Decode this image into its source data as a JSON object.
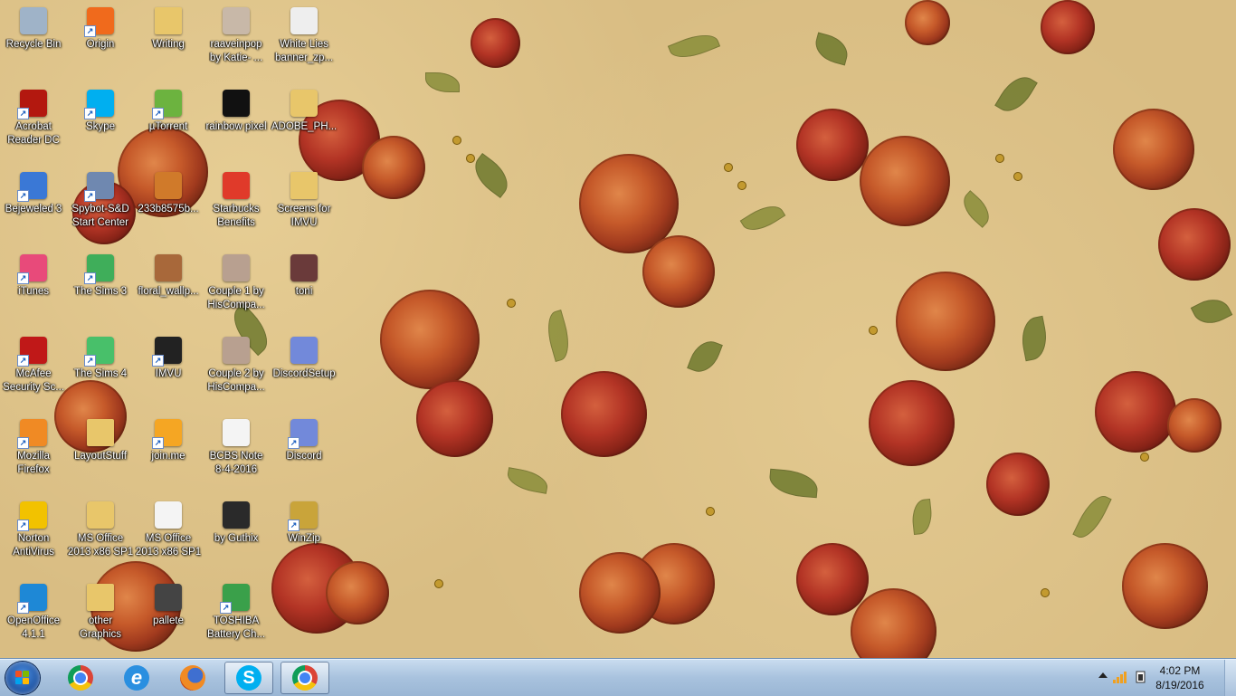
{
  "desktop": {
    "icons": [
      {
        "label": "Recycle Bin",
        "icon": "recycle-bin-icon",
        "color": "#9fb3c8",
        "shortcut": false
      },
      {
        "label": "Origin",
        "icon": "origin-icon",
        "color": "#f06a1c",
        "shortcut": true
      },
      {
        "label": "Writing",
        "icon": "folder-icon",
        "color": "#e8c66a",
        "shortcut": false
      },
      {
        "label": "raaveinpop\nby Katie- ...",
        "icon": "image-file-icon",
        "color": "#c8b8a8",
        "shortcut": false
      },
      {
        "label": "White Lies\nbanner_zp...",
        "icon": "image-file-icon",
        "color": "#eeeeee",
        "shortcut": false
      },
      {
        "label": "Acrobat\nReader DC",
        "icon": "acrobat-icon",
        "color": "#b3180f",
        "shortcut": true
      },
      {
        "label": "Skype",
        "icon": "skype-icon",
        "color": "#00aff0",
        "shortcut": true
      },
      {
        "label": "µTorrent",
        "icon": "utorrent-icon",
        "color": "#6cb33f",
        "shortcut": true
      },
      {
        "label": "rainbow pixel",
        "icon": "image-file-icon",
        "color": "#111111",
        "shortcut": false
      },
      {
        "label": "ADOBE_PH...",
        "icon": "zip-file-icon",
        "color": "#e8c66a",
        "shortcut": false
      },
      {
        "label": "Bejeweled 3",
        "icon": "bejeweled-icon",
        "color": "#3a78d6",
        "shortcut": true
      },
      {
        "label": "Spybot-S&D\nStart Center",
        "icon": "spybot-icon",
        "color": "#6f88b0",
        "shortcut": true
      },
      {
        "label": "233b8575b...",
        "icon": "image-file-icon",
        "color": "#d07a2a",
        "shortcut": false
      },
      {
        "label": "Starbucks\nBenefits",
        "icon": "pdf-file-icon",
        "color": "#e03a2a",
        "shortcut": false
      },
      {
        "label": "Screens for\nIMVU",
        "icon": "folder-icon",
        "color": "#e8c66a",
        "shortcut": false
      },
      {
        "label": "iTunes",
        "icon": "itunes-icon",
        "color": "#e84a7a",
        "shortcut": true
      },
      {
        "label": "The Sims 3",
        "icon": "sims-icon",
        "color": "#3fae5a",
        "shortcut": true
      },
      {
        "label": "floral_wallp...",
        "icon": "image-file-icon",
        "color": "#a8683a",
        "shortcut": false
      },
      {
        "label": "Couple 1 by\nHisCompa...",
        "icon": "image-file-icon",
        "color": "#b8a090",
        "shortcut": false
      },
      {
        "label": "toni",
        "icon": "image-file-icon",
        "color": "#6a3a3a",
        "shortcut": false
      },
      {
        "label": "McAfee\nSecurity Sc...",
        "icon": "mcafee-icon",
        "color": "#c01818",
        "shortcut": true
      },
      {
        "label": "The Sims 4",
        "icon": "sims-icon",
        "color": "#48c06a",
        "shortcut": true
      },
      {
        "label": "IMVU",
        "icon": "imvu-icon",
        "color": "#222222",
        "shortcut": true
      },
      {
        "label": "Couple 2 by\nHisCompa...",
        "icon": "image-file-icon",
        "color": "#b8a090",
        "shortcut": false
      },
      {
        "label": "DiscordSetup",
        "icon": "discord-icon",
        "color": "#7289da",
        "shortcut": false
      },
      {
        "label": "Mozilla\nFirefox",
        "icon": "firefox-icon",
        "color": "#f08a24",
        "shortcut": true
      },
      {
        "label": "LayoutStuff",
        "icon": "folder-icon",
        "color": "#e8c66a",
        "shortcut": false
      },
      {
        "label": "join.me",
        "icon": "joinme-icon",
        "color": "#f5a623",
        "shortcut": true
      },
      {
        "label": "BCBS Note\n8-4-2016",
        "icon": "text-file-icon",
        "color": "#f4f4f4",
        "shortcut": false
      },
      {
        "label": "Discord",
        "icon": "discord-icon",
        "color": "#7289da",
        "shortcut": true
      },
      {
        "label": "Norton\nAntiVirus",
        "icon": "norton-icon",
        "color": "#f2c200",
        "shortcut": true
      },
      {
        "label": "MS Office\n2013 x86 SP1",
        "icon": "zip-file-icon",
        "color": "#e8c66a",
        "shortcut": false
      },
      {
        "label": "MS Office\n2013 x86 SP1",
        "icon": "zip-file-icon",
        "color": "#f4f4f4",
        "shortcut": false
      },
      {
        "label": "by Guthix",
        "icon": "image-file-icon",
        "color": "#2a2a2a",
        "shortcut": false
      },
      {
        "label": "WinZip",
        "icon": "winzip-icon",
        "color": "#c9a43a",
        "shortcut": true
      },
      {
        "label": "OpenOffice\n4.1.1",
        "icon": "openoffice-icon",
        "color": "#1e88d6",
        "shortcut": true
      },
      {
        "label": "other\nGraphics",
        "icon": "folder-icon",
        "color": "#e8c66a",
        "shortcut": false
      },
      {
        "label": "pallete",
        "icon": "image-file-icon",
        "color": "#444444",
        "shortcut": false
      },
      {
        "label": "TOSHIBA\nBattery Ch...",
        "icon": "battery-icon",
        "color": "#3aa04a",
        "shortcut": true
      }
    ]
  },
  "taskbar": {
    "start": "windows-start-icon",
    "pinned": [
      {
        "name": "chrome-icon",
        "active": false
      },
      {
        "name": "internet-explorer-icon",
        "active": false
      },
      {
        "name": "firefox-icon",
        "active": false
      },
      {
        "name": "skype-icon",
        "active": true
      },
      {
        "name": "chrome-icon",
        "active": true
      }
    ],
    "tray": {
      "time": "4:02 PM",
      "date": "8/19/2016"
    }
  }
}
